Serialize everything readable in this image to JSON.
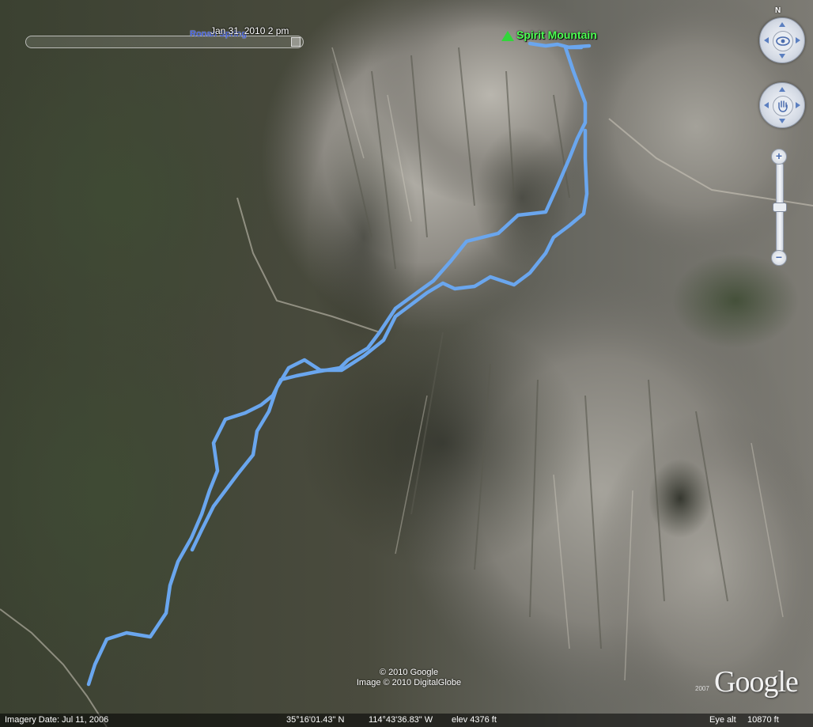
{
  "time_slider": {
    "label": "Jan 31, 2010   2 pm",
    "overlap_label": "Ronan Spring"
  },
  "placemark": {
    "label": "Spirit Mountain",
    "icon": "triangle-placemark-icon",
    "color": "#31d63a"
  },
  "navigation": {
    "north_label": "N",
    "zoom_in_label": "+",
    "zoom_out_label": "−",
    "zoom_level": 0.5
  },
  "track": {
    "color": "#6aa6ee"
  },
  "copyright": {
    "line1": "© 2010 Google",
    "line2": "Image © 2010 DigitalGlobe"
  },
  "logo": {
    "text": "Google",
    "year": "2007"
  },
  "status_bar": {
    "imagery_date": "Imagery Date: Jul 11, 2006",
    "latitude": "35°16'01.43\" N",
    "longitude": "114°43'36.83\" W",
    "elevation": "elev  4376 ft",
    "eye_alt_label": "Eye alt",
    "eye_alt_value": "10870 ft"
  }
}
